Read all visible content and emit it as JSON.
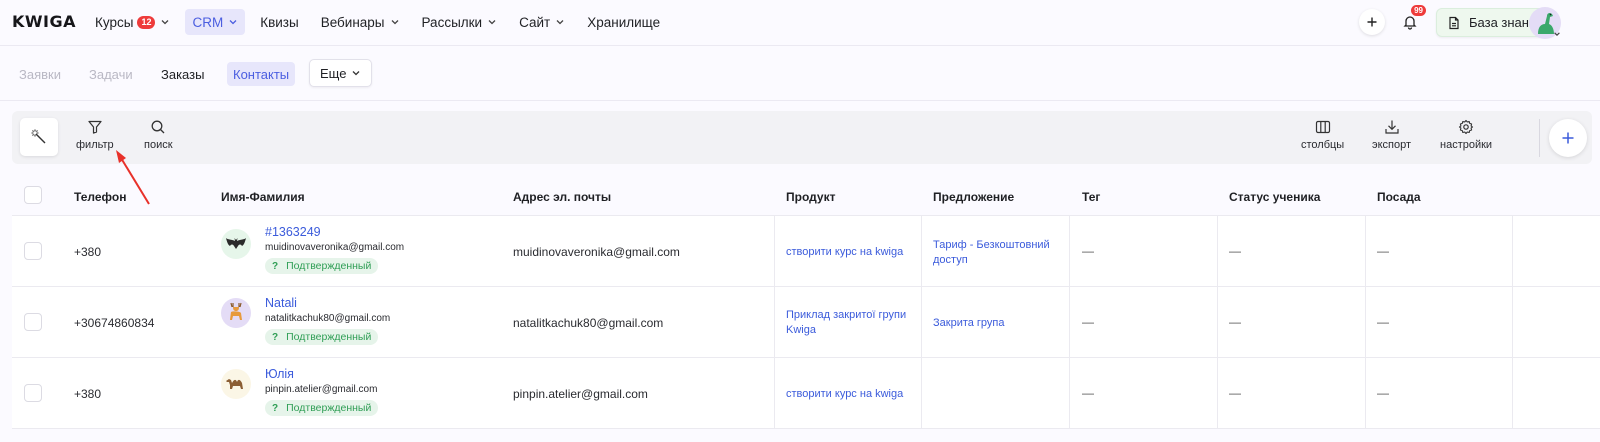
{
  "app": {
    "logo": "KWIGA"
  },
  "nav": {
    "items": [
      {
        "label": "Курсы",
        "badge": "12",
        "dropdown": true
      },
      {
        "label": "CRM",
        "dropdown": true,
        "active": true
      },
      {
        "label": "Квизы"
      },
      {
        "label": "Вебинары",
        "dropdown": true
      },
      {
        "label": "Рассылки",
        "dropdown": true
      },
      {
        "label": "Сайт",
        "dropdown": true
      },
      {
        "label": "Хранилище"
      }
    ],
    "bell_badge": "99",
    "knowledge_base": "База знаний"
  },
  "subnav": {
    "requests": "Заявки",
    "tasks": "Задачи",
    "orders": "Заказы",
    "contacts": "Контакты",
    "more": "Еще"
  },
  "toolbar": {
    "filter": "фильтр",
    "search": "поиск",
    "columns": "столбцы",
    "export": "экспорт",
    "settings": "настройки"
  },
  "table": {
    "headers": [
      "Телефон",
      "Имя-Фамилия",
      "Адрес эл. почты",
      "Продукт",
      "Предложение",
      "Тег",
      "Статус ученика",
      "Посада"
    ],
    "rows": [
      {
        "phone": "+380",
        "name": "#1363249",
        "email_small": "muidinovaveronika@gmail.com",
        "status": "Подтвержденный",
        "status_icon": "?",
        "email": "muidinovaveronika@gmail.com",
        "product": "створити курс на kwiga",
        "offer": "Тариф - Безкоштовний доступ",
        "tag": "—",
        "student_status": "—",
        "position": "—",
        "avatar": "bat-icon"
      },
      {
        "phone": "+30674860834",
        "name": "Natali",
        "email_small": "natalitkachuk80@gmail.com",
        "status": "Подтвержденный",
        "status_icon": "?",
        "email": "natalitkachuk80@gmail.com",
        "product": "Приклад закритої групи Kwiga",
        "offer": "Закрита група",
        "tag": "—",
        "student_status": "—",
        "position": "—",
        "avatar": "deer-icon"
      },
      {
        "phone": "+380",
        "name": "Юлія",
        "email_small": "pinpin.atelier@gmail.com",
        "status": "Подтвержденный",
        "status_icon": "?",
        "email": "pinpin.atelier@gmail.com",
        "product": "створити курс на kwiga",
        "offer": "",
        "tag": "—",
        "student_status": "—",
        "position": "—",
        "avatar": "camel-icon"
      }
    ]
  },
  "colors": {
    "accent": "#4b5ee0",
    "link": "#3b5bdb",
    "badge": "#ee3b3b",
    "status_bg": "#e6f4ea",
    "status_text": "#2f9e55",
    "arrow": "#e8312a"
  }
}
